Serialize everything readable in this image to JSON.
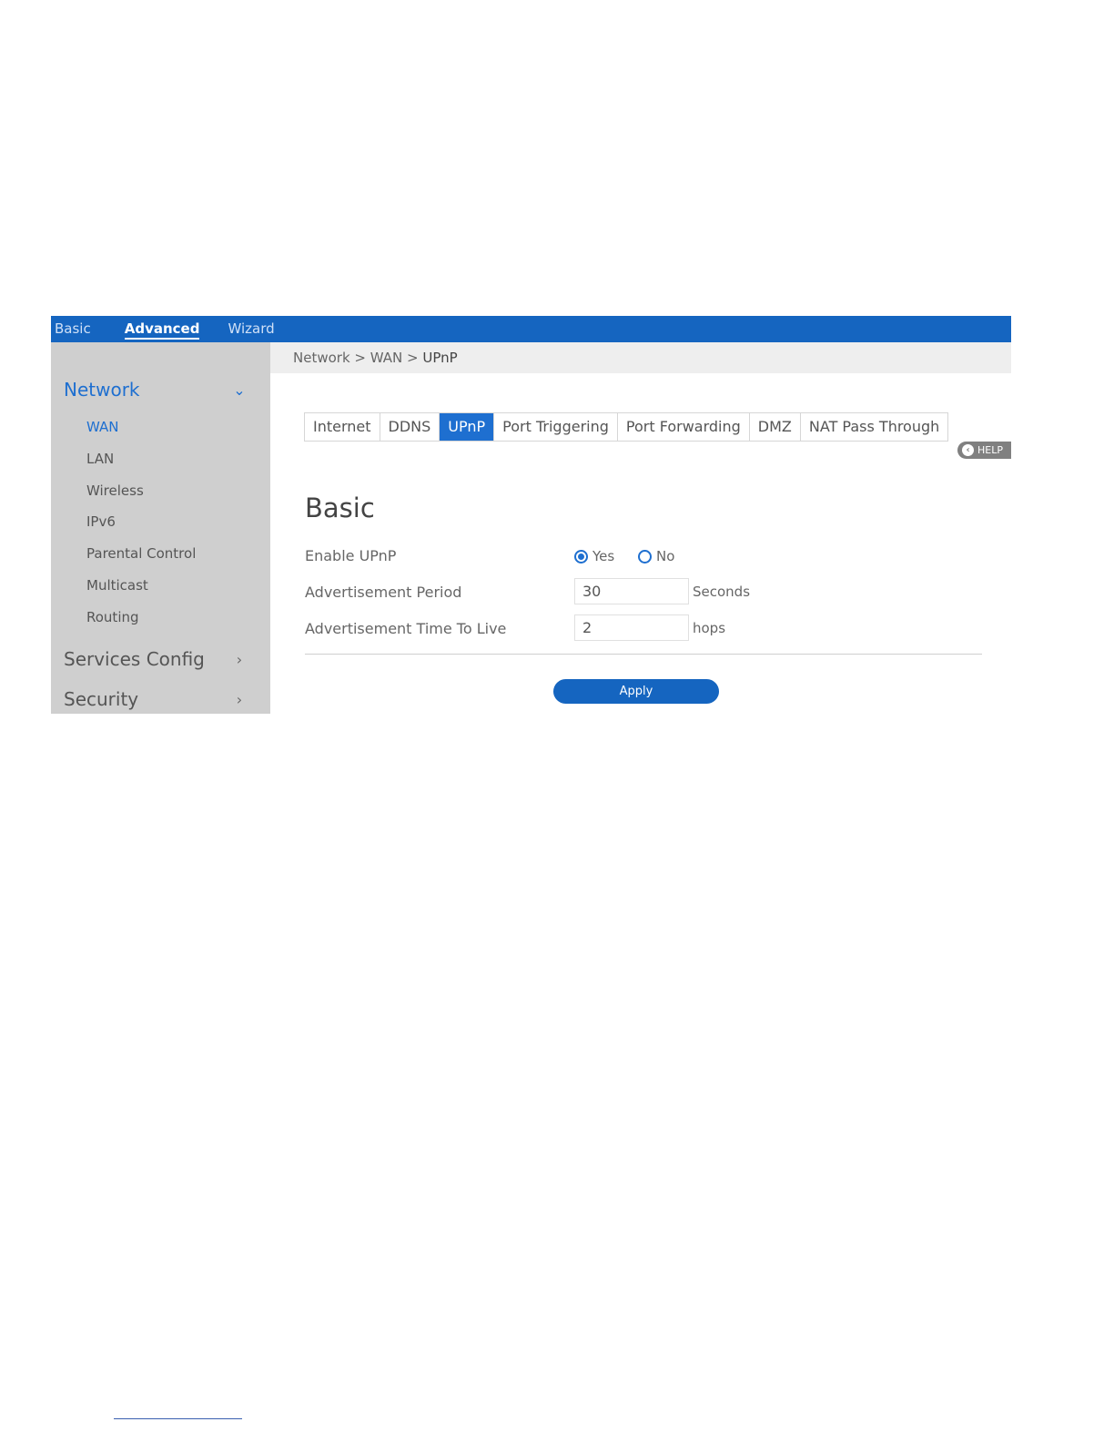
{
  "topbar": {
    "basic": "Basic",
    "advanced": "Advanced",
    "wizard": "Wizard"
  },
  "sidebar": {
    "network": {
      "label": "Network",
      "chevron": "chevron-down-icon"
    },
    "network_items": [
      "WAN",
      "LAN",
      "Wireless",
      "IPv6",
      "Parental Control",
      "Multicast",
      "Routing"
    ],
    "services": {
      "label": "Services Config",
      "chevron": "chevron-right-icon"
    },
    "security": {
      "label": "Security",
      "chevron": "chevron-right-icon"
    }
  },
  "breadcrumb": {
    "path": "Network > WAN > ",
    "current": "UPnP"
  },
  "tabs": [
    "Internet",
    "DDNS",
    "UPnP",
    "Port Triggering",
    "Port Forwarding",
    "DMZ",
    "NAT Pass Through"
  ],
  "active_tab": "UPnP",
  "help": {
    "label": "HELP"
  },
  "section": {
    "title": "Basic"
  },
  "form": {
    "enable_label": "Enable UPnP",
    "yes_label": "Yes",
    "no_label": "No",
    "enable_value": "Yes",
    "period_label": "Advertisement Period",
    "period_value": "30",
    "period_unit": "Seconds",
    "ttl_label": "Advertisement Time To Live",
    "ttl_value": "2",
    "ttl_unit": "hops"
  },
  "apply_label": "Apply",
  "colors": {
    "accent": "#1e6fd0",
    "topbar": "#1565c0",
    "sidebar": "#cfcfcf"
  }
}
